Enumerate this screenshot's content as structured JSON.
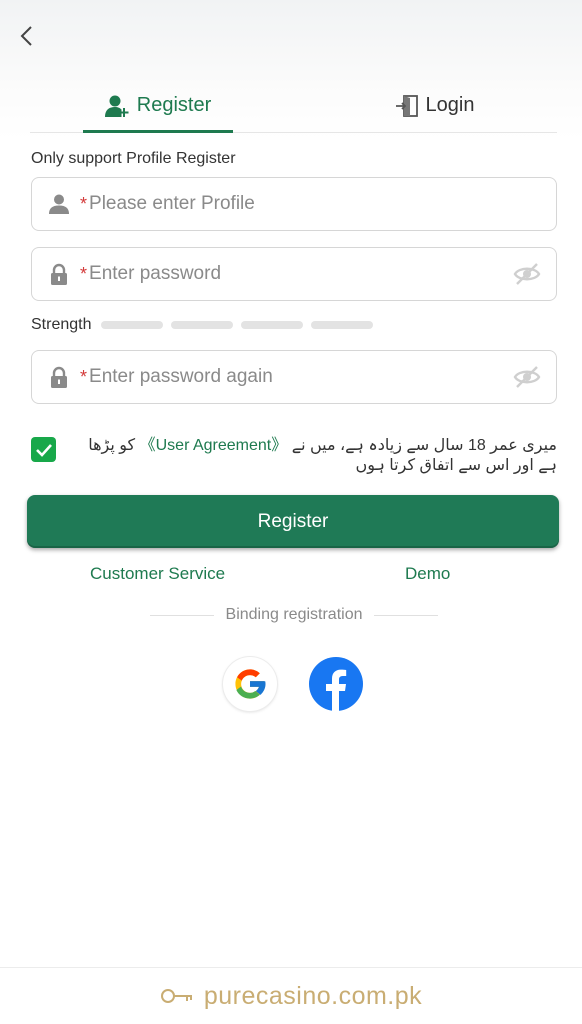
{
  "tabs": {
    "register_label": "Register",
    "login_label": "Login"
  },
  "hint": "Only support Profile Register",
  "fields": {
    "required_mark": "*",
    "profile_placeholder": "Please enter Profile",
    "password_placeholder": "Enter password",
    "password_again_placeholder": "Enter password again"
  },
  "strength_label": "Strength",
  "agreement": {
    "checked": true,
    "text_before": "میری عمر 18 سال سے زیادہ ہے، میں نے",
    "link_label": "《User Agreement》",
    "text_after": "کو پڑھا ہے اور اس سے اتفاق کرتا ہوں"
  },
  "register_button_label": "Register",
  "links": {
    "customer_service": "Customer Service",
    "demo": "Demo"
  },
  "binding_label": "Binding registration",
  "social": [
    "google-icon",
    "facebook-icon"
  ],
  "footer_text": "purecasino.com.pk",
  "colors": {
    "accent": "#1e7a4f",
    "button": "#1f7a56",
    "checkbox": "#18a84a",
    "footer": "#c9ad73",
    "required": "#d33a3a"
  }
}
